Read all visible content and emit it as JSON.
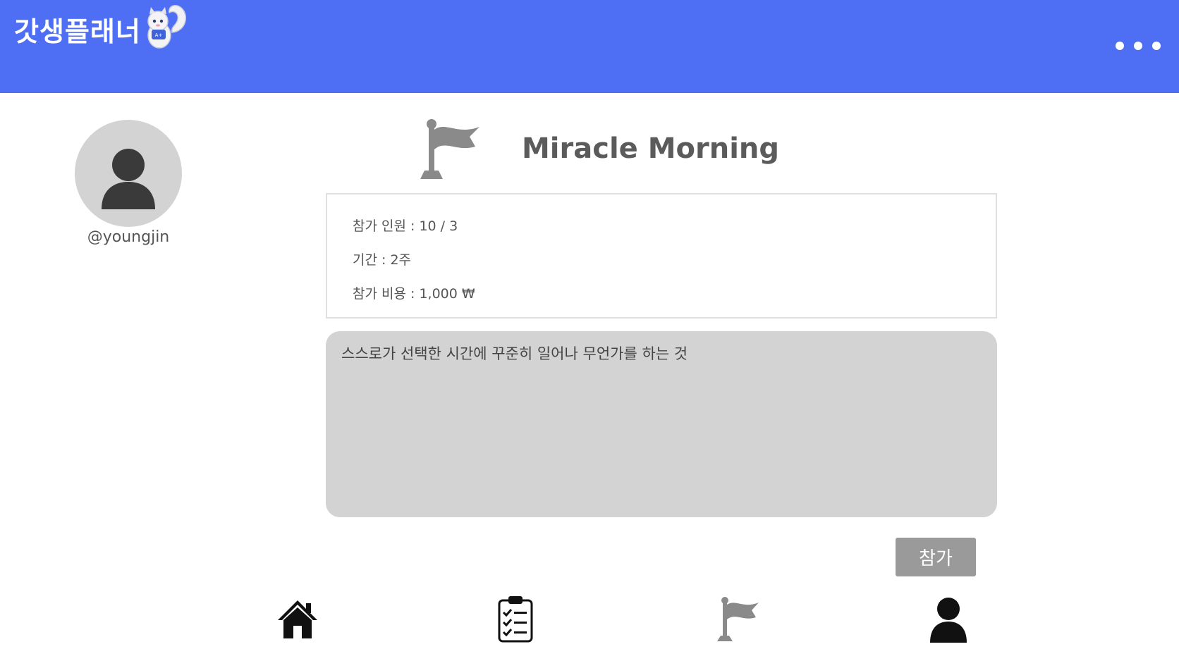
{
  "app": {
    "title": "갓생플래너"
  },
  "icons": {
    "mascot": "squirrel-mascot-icon",
    "menu": "more-horizontal-icon",
    "avatar": "user-avatar-icon",
    "challenge": "flag-icon",
    "nav": [
      "home-icon",
      "clipboard-checklist-icon",
      "flag-icon",
      "user-icon"
    ]
  },
  "profile": {
    "username": "@youngjin"
  },
  "challenge": {
    "title": "Miracle Morning",
    "participants": "참가 인원 : 10 / 3",
    "period": "기간 : 2주",
    "fee": "참가 비용 : 1,000 ₩",
    "description": "스스로가 선택한 시간에 꾸준히 일어나 무언가를 하는 것",
    "join_label": "참가"
  },
  "colors": {
    "header": "#4e6ff4",
    "description_bg": "#d3d3d3",
    "join_button": "#9a9a9a",
    "flag": "#8a8a8a"
  }
}
